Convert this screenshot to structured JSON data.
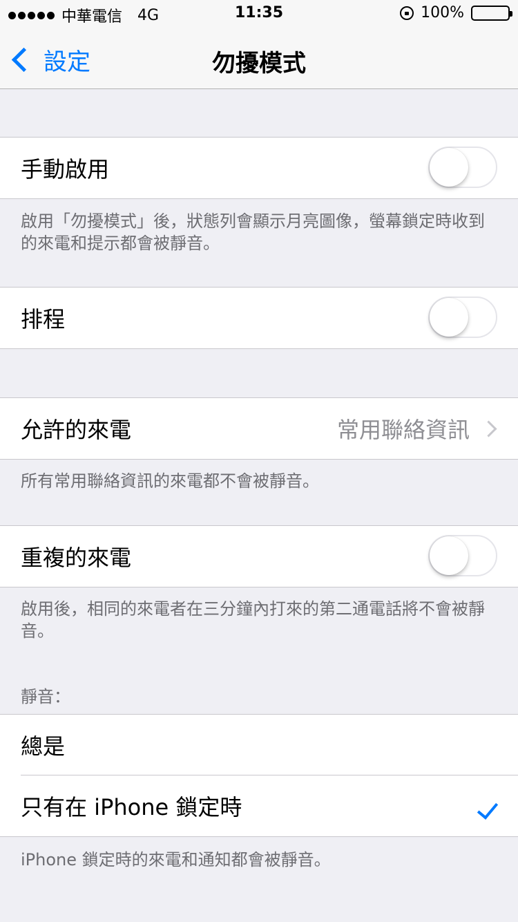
{
  "status_bar": {
    "carrier": "中華電信",
    "network": "4G",
    "time": "11:35",
    "battery": "100%",
    "icons": [
      "signal-dots-icon",
      "orientation-lock-icon",
      "battery-icon"
    ]
  },
  "nav": {
    "back_label": "設定",
    "title": "勿擾模式"
  },
  "manual": {
    "label": "手動啟用",
    "enabled": false,
    "footer": "啟用「勿擾模式」後，狀態列會顯示月亮圖像，螢幕鎖定時收到的來電和提示都會被靜音。"
  },
  "scheduled": {
    "label": "排程",
    "enabled": false
  },
  "allow_calls": {
    "label": "允許的來電",
    "value": "常用聯絡資訊",
    "footer": "所有常用聯絡資訊的來電都不會被靜音。"
  },
  "repeated_calls": {
    "label": "重複的來電",
    "enabled": false,
    "footer": "啟用後，相同的來電者在三分鐘內打來的第二通電話將不會被靜音。"
  },
  "silence": {
    "header": "靜音：",
    "options": [
      {
        "label": "總是",
        "selected": false
      },
      {
        "label": "只有在 iPhone 鎖定時",
        "selected": true
      }
    ],
    "footer": "iPhone 鎖定時的來電和通知都會被靜音。"
  },
  "colors": {
    "accent": "#007aff",
    "background": "#efeff4",
    "secondary_text": "#6d6d72"
  }
}
